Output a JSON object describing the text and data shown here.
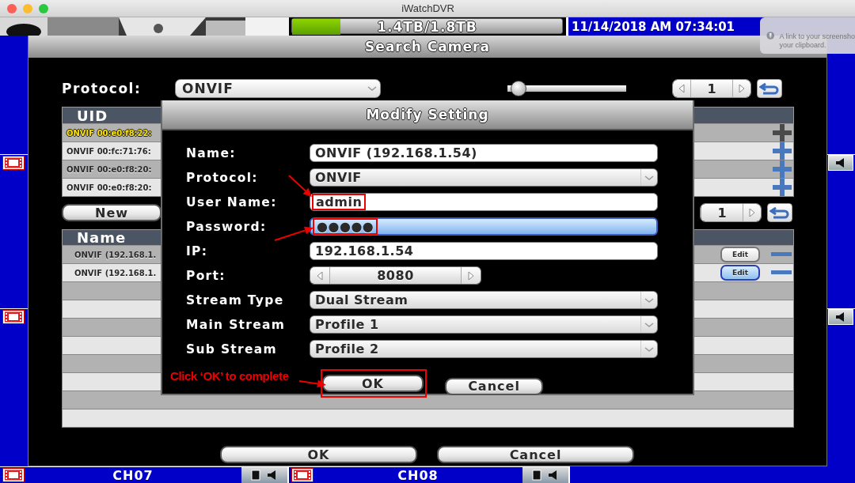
{
  "window": {
    "title": "iWatchDVR"
  },
  "dvr": {
    "storage": {
      "text": "1.4TB/1.8TB",
      "level": 0.18
    },
    "datetime": "11/14/2018 AM 07:34:01",
    "channels": [
      {
        "label": "CH07"
      },
      {
        "label": "CH08"
      }
    ]
  },
  "notification": {
    "lines": [
      "A link to your screensho",
      "your clipboard."
    ]
  },
  "search_camera": {
    "title": "Search Camera",
    "protocol_label": "Protocol:",
    "protocol_value": "ONVIF",
    "slider": {
      "level": 0.03
    },
    "pager": {
      "page": "1"
    },
    "uid_table": {
      "columns": [
        "UID"
      ],
      "rows": [
        {
          "uid": "ONVIF 00:e0:f8:22:",
          "selected": true,
          "disabled": true
        },
        {
          "uid": "ONVIF 00:fc:71:76:",
          "selected": false,
          "disabled": false
        },
        {
          "uid": "ONVIF 00:e0:f8:20:",
          "selected": false,
          "disabled": false
        },
        {
          "uid": "ONVIF 00:e0:f8:20:",
          "selected": false,
          "disabled": false
        }
      ]
    },
    "new_button": "New",
    "pager2": {
      "page": "1"
    },
    "name_table": {
      "columns": [
        "Name"
      ],
      "rows": [
        {
          "name": "ONVIF (192.168.1.",
          "edit": "Edit",
          "selected": false
        },
        {
          "name": "ONVIF (192.168.1.",
          "edit": "Edit",
          "selected": true
        }
      ]
    },
    "buttons": [
      "OK",
      "Cancel"
    ]
  },
  "modify_setting": {
    "title": "Modify Setting",
    "fields": [
      {
        "kind": "text",
        "label": "Name:",
        "value": "ONVIF (192.168.1.54)",
        "focused": false,
        "highlighted": false
      },
      {
        "kind": "select",
        "label": "Protocol:",
        "value": "ONVIF",
        "focused": false,
        "highlighted": false
      },
      {
        "kind": "text",
        "label": "User Name:",
        "value": "admin",
        "focused": false,
        "highlighted": true
      },
      {
        "kind": "password",
        "label": "Password:",
        "value": "●●●●●",
        "focused": true,
        "highlighted": true
      },
      {
        "kind": "text",
        "label": "IP:",
        "value": "192.168.1.54",
        "focused": false,
        "highlighted": false
      },
      {
        "kind": "spinner",
        "label": "Port:",
        "value": "8080",
        "focused": false,
        "highlighted": false
      },
      {
        "kind": "select",
        "label": "Stream Type",
        "value": "Dual Stream",
        "focused": false,
        "highlighted": false
      },
      {
        "kind": "select",
        "label": "Main Stream",
        "value": "Profile 1",
        "focused": false,
        "highlighted": false
      },
      {
        "kind": "select",
        "label": "Sub Stream",
        "value": "Profile 2",
        "focused": false,
        "highlighted": false
      }
    ],
    "buttons": [
      {
        "label": "OK",
        "highlighted": true
      },
      {
        "label": "Cancel",
        "highlighted": false
      }
    ]
  },
  "annotation": {
    "note": "Click ‘OK’ to complete"
  }
}
